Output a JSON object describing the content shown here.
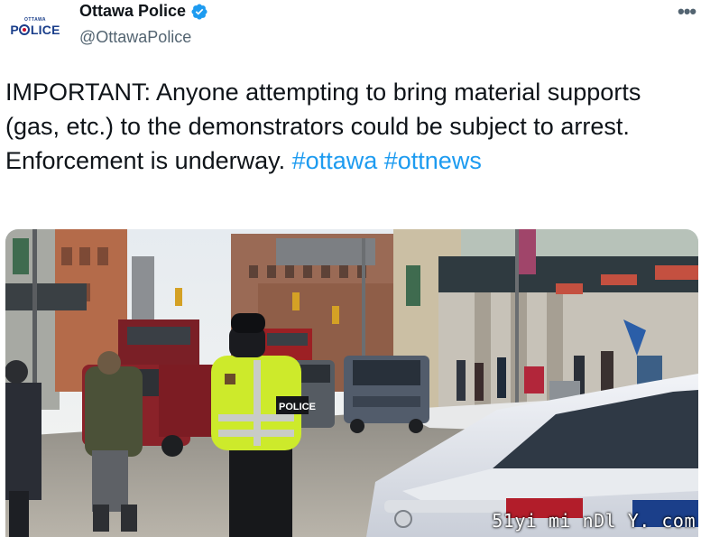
{
  "account": {
    "display_name": "Ottawa Police",
    "handle": "@OttawaPolice",
    "avatar_small": "OTTAWA",
    "avatar_logo_prefix": "P",
    "avatar_logo_suffix": "LICE",
    "verified": true
  },
  "tweet": {
    "text_main": "IMPORTANT: Anyone attempting to bring material supports (gas, etc.) to the demonstrators could be subject to arrest. Enforcement is underway. ",
    "hashtags": [
      "#ottawa",
      "#ottnews"
    ]
  },
  "media": {
    "kind": "photo",
    "vest_text": "POLICE",
    "watermark": "51yi mi nDl Y. com"
  },
  "icons": {
    "menu": "more-horizontal-icon",
    "verified": "verified-badge-icon"
  },
  "colors": {
    "hashtag": "#1d9bf0",
    "secondary_text": "#536471",
    "verified": "#1d9bf0"
  },
  "more_glyph": "•••"
}
